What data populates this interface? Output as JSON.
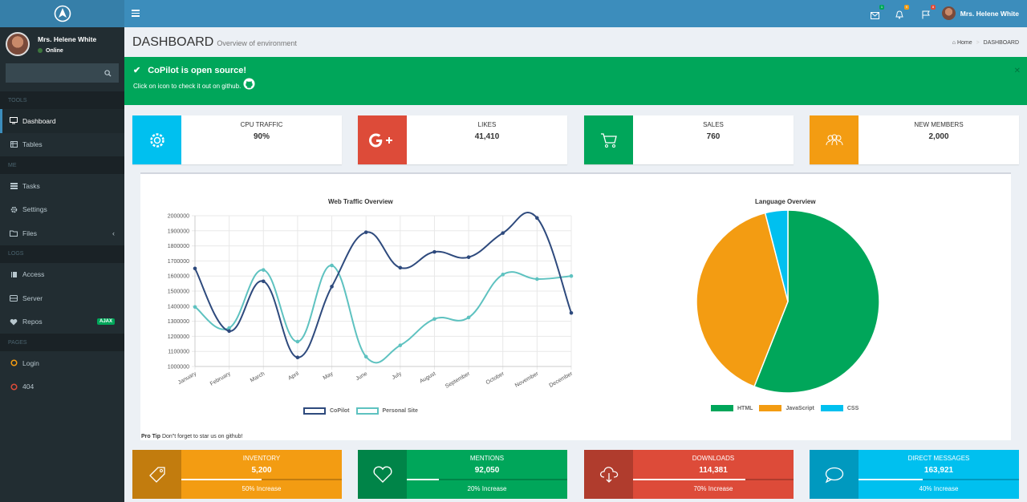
{
  "sidebar": {
    "user": {
      "name": "Mrs. Helene White",
      "status": "Online"
    },
    "search_placeholder": "",
    "sections": [
      {
        "heading": "TOOLS",
        "items": [
          {
            "label": "Dashboard",
            "icon": "desktop-icon"
          },
          {
            "label": "Tables",
            "icon": "table-icon"
          }
        ]
      },
      {
        "heading": "ME",
        "items": [
          {
            "label": "Tasks",
            "icon": "tasks-icon"
          },
          {
            "label": "Settings",
            "icon": "gear-icon"
          },
          {
            "label": "Files",
            "icon": "folder-icon"
          }
        ]
      },
      {
        "heading": "LOGS",
        "items": [
          {
            "label": "Access",
            "icon": "book-icon"
          },
          {
            "label": "Server",
            "icon": "server-icon"
          },
          {
            "label": "Repos",
            "icon": "heart-icon",
            "badge": "AJAX"
          }
        ]
      },
      {
        "heading": "PAGES",
        "items": [
          {
            "label": "Login",
            "icon": "circle-icon"
          },
          {
            "label": "404",
            "icon": "circle-icon"
          }
        ]
      }
    ]
  },
  "topbar": {
    "user_name": "Mrs. Helene White",
    "badges": {
      "messages": "1",
      "notifications": "9",
      "flags": "8"
    }
  },
  "header": {
    "title": "DASHBOARD",
    "subtitle": "Overview of environment",
    "breadcrumb_home": "Home",
    "breadcrumb_current": "DASHBOARD"
  },
  "alert": {
    "title": "CoPilot is open source!",
    "text": "Click on icon to check it out on github."
  },
  "info_boxes": [
    {
      "title": "CPU TRAFFIC",
      "value": "90%",
      "color": "#00c0ef",
      "icon": "gear-icon"
    },
    {
      "title": "LIKES",
      "value": "41,410",
      "color": "#dd4b39",
      "icon": "google-plus-icon"
    },
    {
      "title": "SALES",
      "value": "760",
      "color": "#00a65a",
      "icon": "cart-icon"
    },
    {
      "title": "NEW MEMBERS",
      "value": "2,000",
      "color": "#f39c12",
      "icon": "users-icon"
    }
  ],
  "chart_data": [
    {
      "type": "line",
      "title": "Web Traffic Overview",
      "categories": [
        "January",
        "February",
        "March",
        "April",
        "May",
        "June",
        "July",
        "August",
        "September",
        "October",
        "November",
        "December"
      ],
      "ylim": [
        1000000,
        2000000
      ],
      "yticks": [
        "2000000",
        "1900000",
        "1800000",
        "1700000",
        "1600000",
        "1500000",
        "1400000",
        "1300000",
        "1200000",
        "1100000",
        "1000000"
      ],
      "series": [
        {
          "name": "CoPilot",
          "color": "#2e4a7d",
          "values": [
            1650000,
            1235000,
            1565000,
            1060000,
            1530000,
            1890000,
            1655000,
            1760000,
            1725000,
            1885000,
            1985000,
            1355000
          ]
        },
        {
          "name": "Personal Site",
          "color": "#5ec2c0",
          "values": [
            1395000,
            1255000,
            1640000,
            1165000,
            1670000,
            1065000,
            1140000,
            1315000,
            1325000,
            1610000,
            1580000,
            1600000
          ]
        }
      ],
      "grid": true,
      "legend": "bottom"
    },
    {
      "type": "pie",
      "title": "Language Overview",
      "labels": [
        "HTML",
        "JavaScript",
        "CSS"
      ],
      "values": [
        56,
        40,
        4
      ],
      "colors": [
        "#00a65a",
        "#f39c12",
        "#00c0ef"
      ],
      "legend": "bottom"
    }
  ],
  "protip": {
    "label": "Pro Tip",
    "text": "Don\"t forget to star us on github!"
  },
  "stat_boxes": [
    {
      "title": "INVENTORY",
      "value": "5,200",
      "progress": 50,
      "desc": "50% Increase",
      "color": "#f39c12",
      "icon": "tag-icon"
    },
    {
      "title": "MENTIONS",
      "value": "92,050",
      "progress": 20,
      "desc": "20% Increase",
      "color": "#00a65a",
      "icon": "heart-outline-icon"
    },
    {
      "title": "DOWNLOADS",
      "value": "114,381",
      "progress": 70,
      "desc": "70% Increase",
      "color": "#dd4b39",
      "icon": "cloud-download-icon"
    },
    {
      "title": "DIRECT MESSAGES",
      "value": "163,921",
      "progress": 40,
      "desc": "40% Increase",
      "color": "#00c0ef",
      "icon": "comment-icon"
    }
  ]
}
